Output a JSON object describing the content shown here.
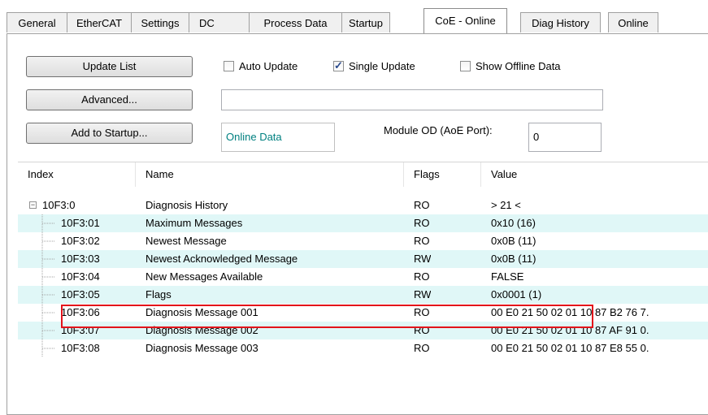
{
  "tabs": [
    "General",
    "EtherCAT",
    "Settings",
    "DC",
    "Process Data",
    "Startup",
    "CoE - Online",
    "Diag History",
    "Online"
  ],
  "active_tab": "CoE - Online",
  "buttons": {
    "update_list": "Update List",
    "advanced": "Advanced...",
    "add_to_startup": "Add to Startup..."
  },
  "options": {
    "auto_update": {
      "label": "Auto Update",
      "checked": false
    },
    "single_update": {
      "label": "Single Update",
      "checked": true
    },
    "show_offline": {
      "label": "Show Offline Data",
      "checked": false
    }
  },
  "advanced_field": {
    "value": ""
  },
  "online_data": "Online Data",
  "module_od": {
    "label": "Module OD (AoE Port):",
    "value": "0"
  },
  "columns": {
    "index": "Index",
    "name": "Name",
    "flags": "Flags",
    "value": "Value"
  },
  "rows": [
    {
      "index": "10F3:0",
      "name": "Diagnosis History",
      "flags": "RO",
      "value": "> 21 <"
    },
    {
      "index": "10F3:01",
      "name": "Maximum Messages",
      "flags": "RO",
      "value": "0x10 (16)"
    },
    {
      "index": "10F3:02",
      "name": "Newest Message",
      "flags": "RO",
      "value": "0x0B (11)"
    },
    {
      "index": "10F3:03",
      "name": "Newest Acknowledged Message",
      "flags": "RW",
      "value": "0x0B (11)"
    },
    {
      "index": "10F3:04",
      "name": "New Messages Available",
      "flags": "RO",
      "value": "FALSE"
    },
    {
      "index": "10F3:05",
      "name": "Flags",
      "flags": "RW",
      "value": "0x0001 (1)"
    },
    {
      "index": "10F3:06",
      "name": "Diagnosis Message 001",
      "flags": "RO",
      "value": "00 E0 21 50 02 01 10 87 B2 76 7."
    },
    {
      "index": "10F3:07",
      "name": "Diagnosis Message 002",
      "flags": "RO",
      "value": "00 E0 21 50 02 01 10 87 AF 91 0."
    },
    {
      "index": "10F3:08",
      "name": "Diagnosis Message 003",
      "flags": "RO",
      "value": "00 E0 21 50 02 01 10 87 E8 55 0."
    }
  ],
  "colors": {
    "alt_row": "#e0f7f7",
    "highlight": "#e3141b"
  }
}
